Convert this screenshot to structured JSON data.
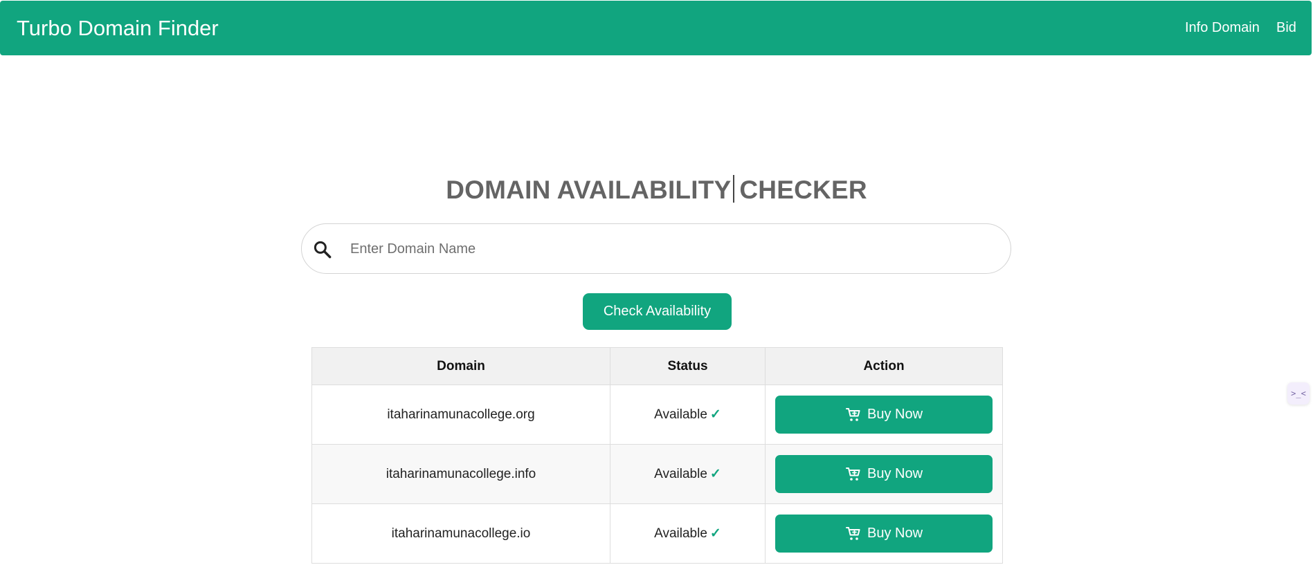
{
  "navbar": {
    "brand": "Turbo Domain Finder",
    "links": [
      "Info Domain",
      "Bid"
    ],
    "color": "#11a57f"
  },
  "main": {
    "title_part1": "DOMAIN AVAILABILITY",
    "title_part2": "CHECKER",
    "search": {
      "placeholder": "Enter Domain Name",
      "value": "",
      "icon": "search-icon"
    },
    "check_button": "Check Availability"
  },
  "results": {
    "headers": [
      "Domain",
      "Status",
      "Action"
    ],
    "rows": [
      {
        "domain": "itaharinamunacollege.org",
        "status": "Available",
        "status_icon": "check-icon",
        "action": "Buy Now",
        "action_icon": "cart-icon"
      },
      {
        "domain": "itaharinamunacollege.info",
        "status": "Available",
        "status_icon": "check-icon",
        "action": "Buy Now",
        "action_icon": "cart-icon"
      },
      {
        "domain": "itaharinamunacollege.io",
        "status": "Available",
        "status_icon": "check-icon",
        "action": "Buy Now",
        "action_icon": "cart-icon"
      }
    ]
  },
  "widget": {
    "label": ">_<",
    "icon": "assistant-widget-icon"
  }
}
